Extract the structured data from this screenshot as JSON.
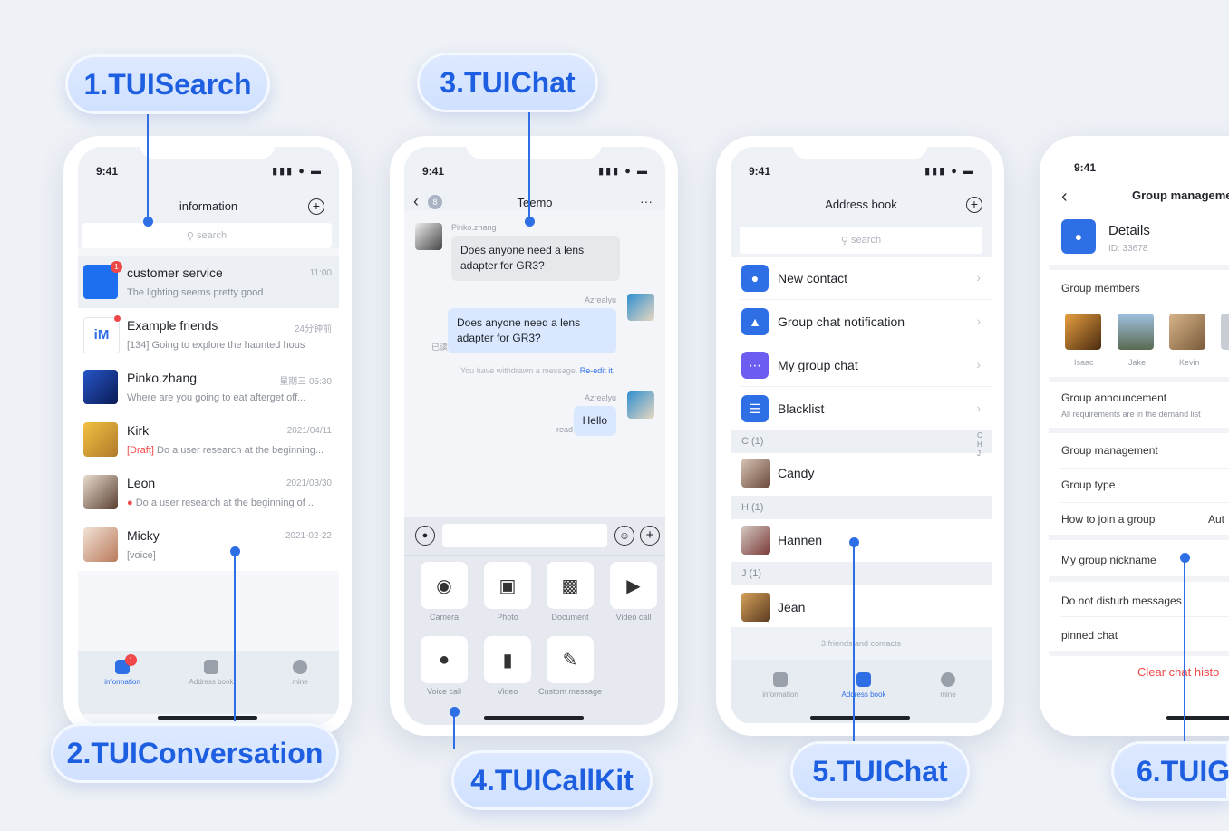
{
  "labels": {
    "l1": "1.TUISearch",
    "l2": "2.TUIConversation",
    "l3": "3.TUIChat",
    "l4": "4.TUICallKit",
    "l5": "5.TUIChat",
    "l6": "6.TUIG"
  },
  "common": {
    "time": "9:41",
    "status": "▮▮▮ ● ▬"
  },
  "p1": {
    "title": "information",
    "search": "search",
    "items": [
      {
        "name": "customer service",
        "sub": "The lighting seems pretty good",
        "ts": "11:00",
        "badge": "1"
      },
      {
        "name": "Example friends",
        "sub": "[134] Going to explore the haunted hous",
        "ts": "24分钟前"
      },
      {
        "name": "Pinko.zhang",
        "sub": "Where are you going to eat afterget off...",
        "ts": "星期三 05:30"
      },
      {
        "name": "Kirk",
        "draft": "[Draft]",
        "sub": " Do a user research at the beginning...",
        "ts": "2021/04/11"
      },
      {
        "name": "Leon",
        "sub": "Do a user research at the beginning of ...",
        "ts": "2021/03/30"
      },
      {
        "name": "Micky",
        "sub": "[voice]",
        "ts": "2021-02-22"
      }
    ],
    "tabs": [
      "information",
      "Address book",
      "mine"
    ],
    "tab_badge": "1"
  },
  "p2": {
    "title": "Teemo",
    "back_badge": "8",
    "more": "···",
    "sender1": "Pinko.zhang",
    "msg1": "Does anyone need a lens adapter for GR3?",
    "sender2": "Azrealyu",
    "msg2": "Does anyone need a lens adapter for GR3?",
    "read_cn": "已读",
    "withdraw": "You have withdrawn a message.",
    "reedit": "Re-edit it.",
    "sender3": "Azrealyu",
    "msg3": "Hello",
    "read": "read",
    "tools": [
      "Camera",
      "Photo",
      "Document",
      "Video call",
      "Voice call",
      "Video",
      "Custom message"
    ]
  },
  "p3": {
    "title": "Address book",
    "search": "search",
    "menu": [
      "New contact",
      "Group chat notification",
      "My group chat",
      "Blacklist"
    ],
    "sec_c": "C  (1)",
    "sec_h": "H  (1)",
    "sec_j": "J  (1)",
    "contacts": [
      "Candy",
      "Hannen",
      "Jean"
    ],
    "index": "C\nH\nJ",
    "footer": "3 friends and contacts",
    "tabs": [
      "information",
      "Address book",
      "mine"
    ]
  },
  "p4": {
    "title": "Group manageme",
    "details": "Details",
    "id": "ID:  33678",
    "members_label": "Group members",
    "members": [
      "Isaac",
      "Jake",
      "Kevin"
    ],
    "announce": "Group announcement",
    "announce_sub": "All requirements are in the demand list",
    "management": "Group management",
    "type": "Group type",
    "join": "How to join a group",
    "join_val": "Aut",
    "nickname": "My group nickname",
    "dnd": "Do not disturb messages",
    "pinned": "pinned chat",
    "clear": "Clear chat histo"
  }
}
